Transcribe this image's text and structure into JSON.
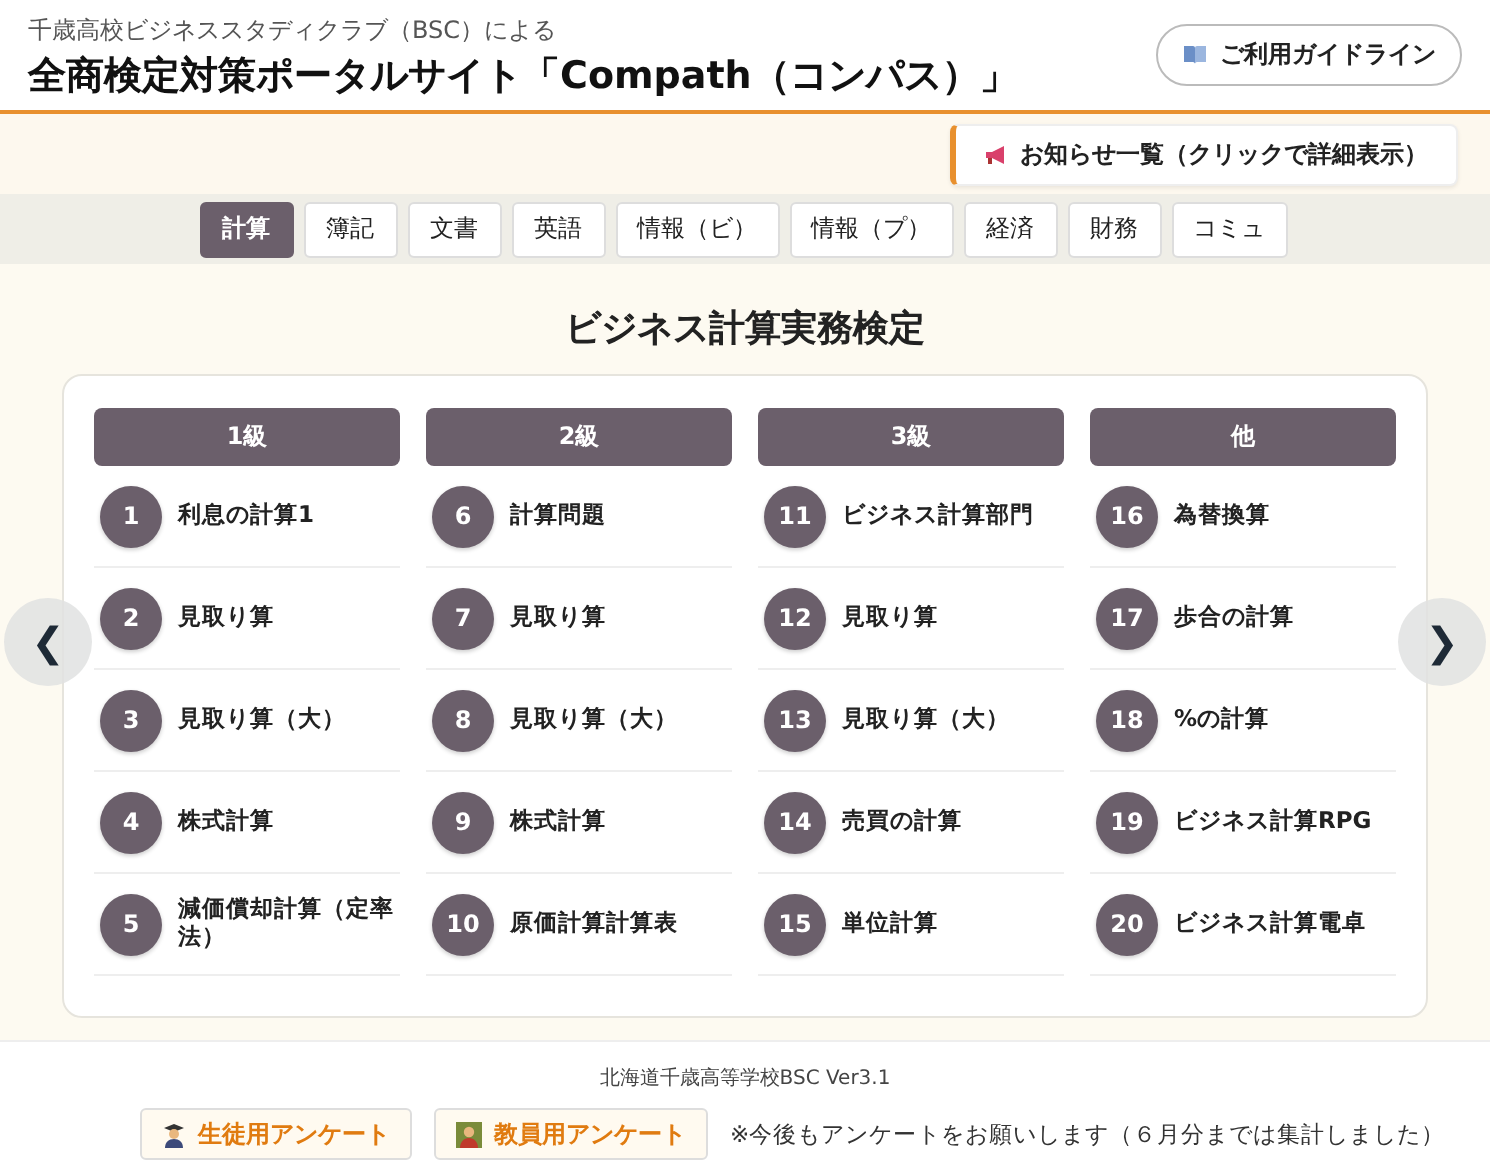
{
  "header": {
    "subtitle": "千歳高校ビジネススタディクラブ（BSC）による",
    "title": "全商検定対策ポータルサイト「Compath（コンパス）」",
    "guide_button": "ご利用ガイドライン"
  },
  "notice_button": "お知らせ一覧（クリックで詳細表示）",
  "tabs": [
    {
      "label": "計算",
      "selected": true
    },
    {
      "label": "簿記",
      "selected": false
    },
    {
      "label": "文書",
      "selected": false
    },
    {
      "label": "英語",
      "selected": false
    },
    {
      "label": "情報（ビ）",
      "selected": false
    },
    {
      "label": "情報（プ）",
      "selected": false
    },
    {
      "label": "経済",
      "selected": false
    },
    {
      "label": "財務",
      "selected": false
    },
    {
      "label": "コミュ",
      "selected": false
    }
  ],
  "section_title": "ビジネス計算実務検定",
  "prev_button": "❮",
  "next_button": "❯",
  "columns": [
    {
      "heading": "1級",
      "items": [
        {
          "number": "1",
          "label": "利息の計算1"
        },
        {
          "number": "2",
          "label": "見取り算"
        },
        {
          "number": "3",
          "label": "見取り算（大）"
        },
        {
          "number": "4",
          "label": "株式計算"
        },
        {
          "number": "5",
          "label": "減価償却計算（定率法）"
        }
      ]
    },
    {
      "heading": "2級",
      "items": [
        {
          "number": "6",
          "label": "計算問題"
        },
        {
          "number": "7",
          "label": "見取り算"
        },
        {
          "number": "8",
          "label": "見取り算（大）"
        },
        {
          "number": "9",
          "label": "株式計算"
        },
        {
          "number": "10",
          "label": "原価計算計算表"
        }
      ]
    },
    {
      "heading": "3級",
      "items": [
        {
          "number": "11",
          "label": "ビジネス計算部門"
        },
        {
          "number": "12",
          "label": "見取り算"
        },
        {
          "number": "13",
          "label": "見取り算（大）"
        },
        {
          "number": "14",
          "label": "売買の計算"
        },
        {
          "number": "15",
          "label": "単位計算"
        }
      ]
    },
    {
      "heading": "他",
      "items": [
        {
          "number": "16",
          "label": "為替換算"
        },
        {
          "number": "17",
          "label": "歩合の計算"
        },
        {
          "number": "18",
          "label": "%の計算"
        },
        {
          "number": "19",
          "label": "ビジネス計算RPG"
        },
        {
          "number": "20",
          "label": "ビジネス計算電卓"
        }
      ]
    }
  ],
  "footer": {
    "version": "北海道千歳高等学校BSC Ver3.1",
    "survey_buttons": [
      {
        "kind": "student",
        "label": "生徒用アンケート"
      },
      {
        "kind": "teacher",
        "label": "教員用アンケート"
      }
    ],
    "note": "※今後もアンケートをお願いします（６月分までは集計しました）"
  }
}
